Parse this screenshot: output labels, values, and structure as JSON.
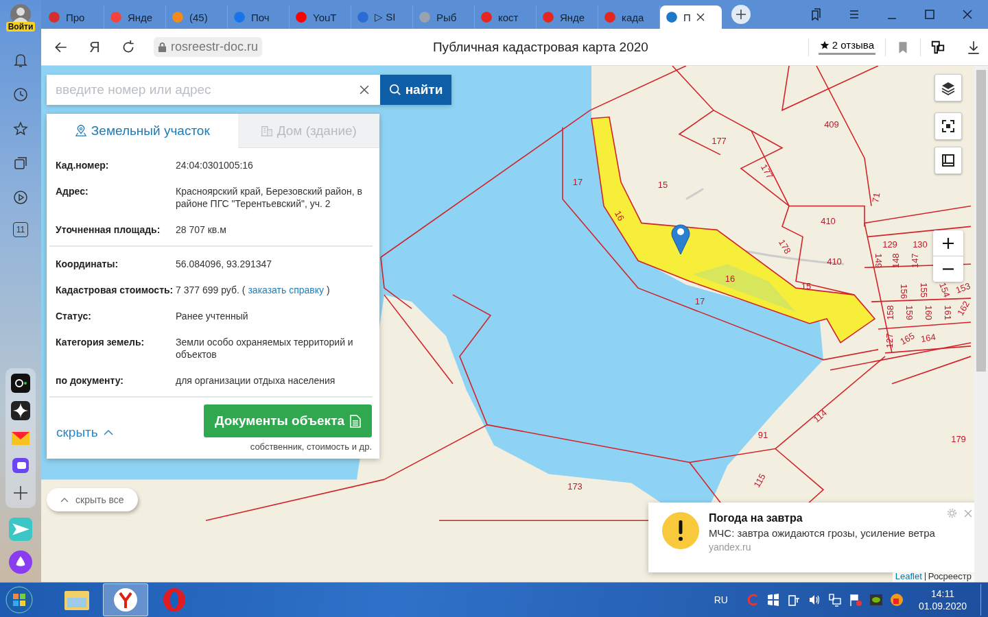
{
  "browser": {
    "profile": {
      "login": "Войти"
    },
    "tabs": [
      {
        "title": "Про",
        "selected": false
      },
      {
        "title": "Янде",
        "selected": false
      },
      {
        "title": "(45)",
        "selected": false
      },
      {
        "title": "Поч",
        "selected": false
      },
      {
        "title": "YouT",
        "selected": false
      },
      {
        "title": "▷ SI",
        "selected": false
      },
      {
        "title": "Рыб",
        "selected": false
      },
      {
        "title": "кост",
        "selected": false
      },
      {
        "title": "Янде",
        "selected": false
      },
      {
        "title": "када",
        "selected": false
      },
      {
        "title": "П",
        "selected": true
      }
    ],
    "address": {
      "brand": "Я",
      "url": "rosreestr-doc.ru",
      "page_title": "Публичная кадастровая карта 2020",
      "reviews": "2 отзыва"
    },
    "sidebar": {
      "calendar_day": "11"
    }
  },
  "search": {
    "placeholder": "введите номер или адрес",
    "button": "найти"
  },
  "card": {
    "tabs": [
      {
        "label": "Земельный участок",
        "selected": true
      },
      {
        "label": "Дом (здание)",
        "selected": false
      }
    ],
    "sections": [
      [
        {
          "label": "Кад.номер:",
          "value": "24:04:0301005:16"
        },
        {
          "label": "Адрес:",
          "value": "Красноярский край, Березовский район, в районе ПГС \"Терентьевский\", уч. 2"
        },
        {
          "label": "Уточненная площадь:",
          "value": "28 707 кв.м"
        }
      ],
      [
        {
          "label": "Координаты:",
          "value": "56.084096, 93.291347"
        },
        {
          "label": "Кадастровая стоимость:",
          "value": "7 377 699 руб. (",
          "link": "заказать справку",
          "value_after": ")"
        },
        {
          "label": "Статус:",
          "value": "Ранее учтенный"
        },
        {
          "label": "Категория земель:",
          "value": "Земли особо охраняемых территорий и объектов"
        },
        {
          "label": "по документу:",
          "value": "для организации отдыха населения"
        }
      ]
    ],
    "hide": "скрыть",
    "documents_button": "Документы объекта",
    "documents_caption": "собственник, стоимость и др."
  },
  "hide_all": "скрыть все",
  "map": {
    "parcel_labels": [
      "409",
      "177",
      "177",
      "17",
      "15",
      "71",
      "410",
      "410",
      "129",
      "130",
      "16",
      "16",
      "178",
      "15",
      "17",
      "149",
      "148",
      "147",
      "156",
      "155",
      "154",
      "153",
      "158",
      "159",
      "160",
      "161",
      "162",
      "127",
      "165",
      "164",
      "114",
      "91",
      "179",
      "173",
      "115"
    ],
    "attribution": {
      "link": "Leaflet",
      "source": "Росреестр"
    }
  },
  "notification": {
    "title": "Погода на завтра",
    "message": "МЧС: завтра ожидаются грозы, усиление ветра",
    "source": "yandex.ru"
  },
  "taskbar": {
    "language": "RU",
    "time": "14:11",
    "date": "01.09.2020",
    "apps": [
      {
        "selected": false
      },
      {
        "selected": true
      },
      {
        "selected": false
      }
    ]
  }
}
